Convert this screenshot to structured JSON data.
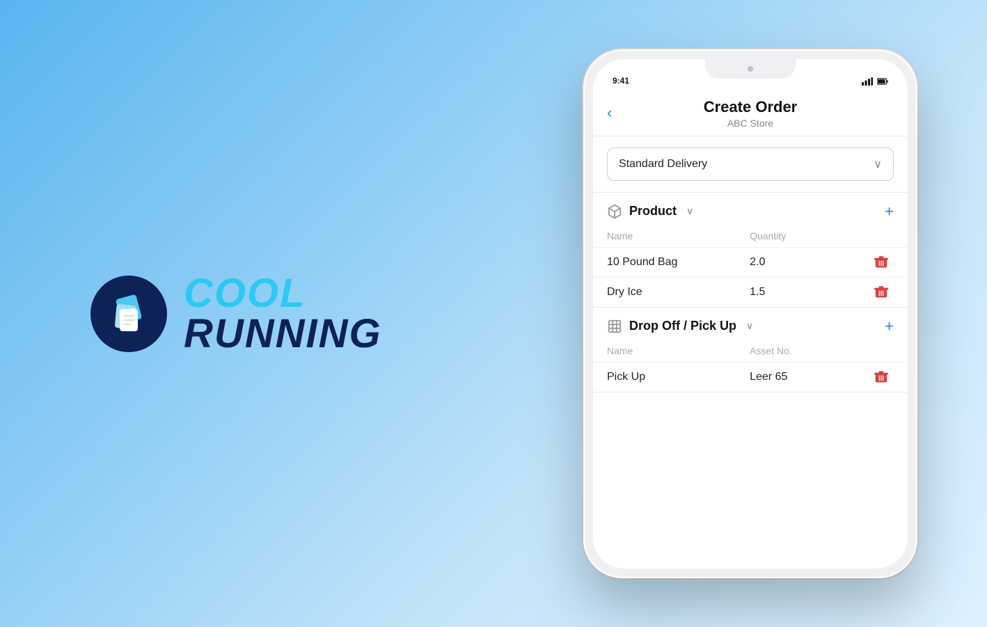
{
  "background": {
    "gradient_start": "#5ab4f0",
    "gradient_end": "#e8f4ff"
  },
  "logo": {
    "cool_text": "COOL",
    "running_text": "RUNNING"
  },
  "phone": {
    "header": {
      "back_label": "‹",
      "title": "Create Order",
      "subtitle": "ABC Store"
    },
    "delivery": {
      "label": "Standard Delivery",
      "chevron": "❯"
    },
    "product_section": {
      "icon": "📦",
      "title": "Product",
      "chevron": "∨",
      "add_button": "+",
      "columns": {
        "name": "Name",
        "quantity": "Quantity"
      },
      "rows": [
        {
          "name": "10 Pound Bag",
          "quantity": "2.0"
        },
        {
          "name": "Dry Ice",
          "quantity": "1.5"
        }
      ]
    },
    "dropoff_section": {
      "icon": "▦",
      "title": "Drop Off / Pick Up",
      "chevron": "∨",
      "add_button": "+",
      "columns": {
        "name": "Name",
        "asset": "Asset No."
      },
      "rows": [
        {
          "name": "Pick Up",
          "asset": "Leer 65"
        }
      ]
    }
  }
}
